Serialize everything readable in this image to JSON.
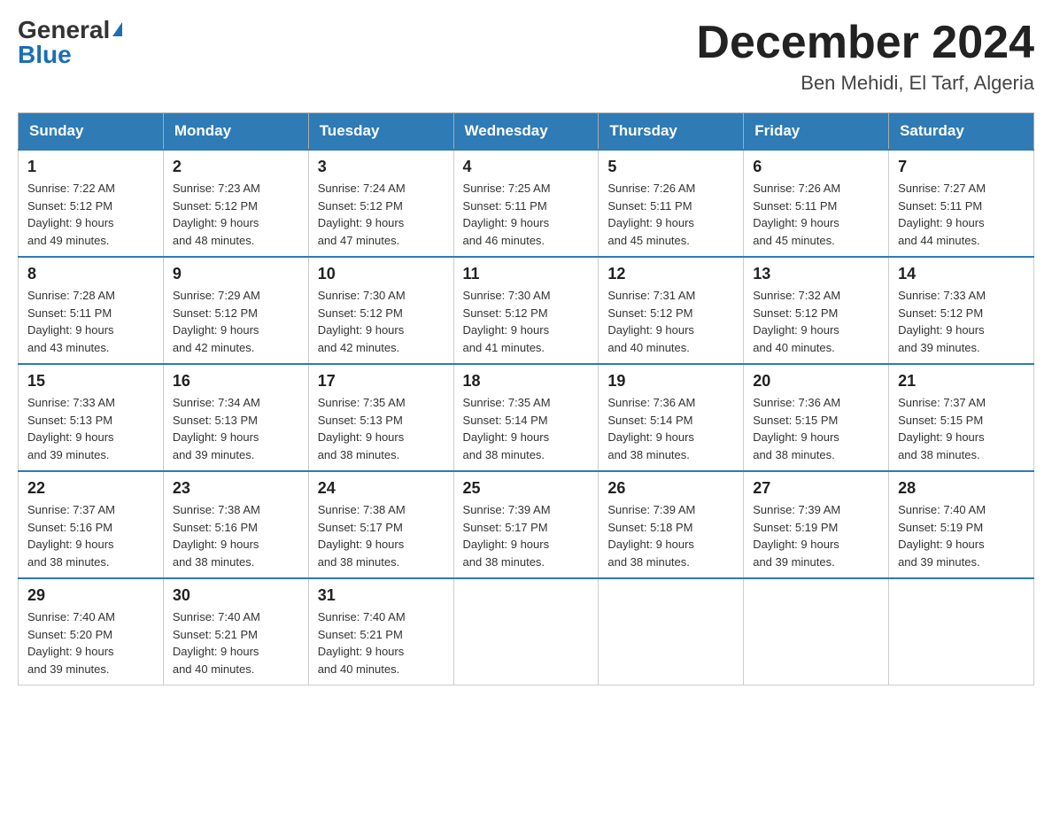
{
  "header": {
    "logo_general": "General",
    "logo_blue": "Blue",
    "month_title": "December 2024",
    "location": "Ben Mehidi, El Tarf, Algeria"
  },
  "days_of_week": [
    "Sunday",
    "Monday",
    "Tuesday",
    "Wednesday",
    "Thursday",
    "Friday",
    "Saturday"
  ],
  "weeks": [
    [
      {
        "day": "1",
        "sunrise": "7:22 AM",
        "sunset": "5:12 PM",
        "daylight": "9 hours and 49 minutes."
      },
      {
        "day": "2",
        "sunrise": "7:23 AM",
        "sunset": "5:12 PM",
        "daylight": "9 hours and 48 minutes."
      },
      {
        "day": "3",
        "sunrise": "7:24 AM",
        "sunset": "5:12 PM",
        "daylight": "9 hours and 47 minutes."
      },
      {
        "day": "4",
        "sunrise": "7:25 AM",
        "sunset": "5:11 PM",
        "daylight": "9 hours and 46 minutes."
      },
      {
        "day": "5",
        "sunrise": "7:26 AM",
        "sunset": "5:11 PM",
        "daylight": "9 hours and 45 minutes."
      },
      {
        "day": "6",
        "sunrise": "7:26 AM",
        "sunset": "5:11 PM",
        "daylight": "9 hours and 45 minutes."
      },
      {
        "day": "7",
        "sunrise": "7:27 AM",
        "sunset": "5:11 PM",
        "daylight": "9 hours and 44 minutes."
      }
    ],
    [
      {
        "day": "8",
        "sunrise": "7:28 AM",
        "sunset": "5:11 PM",
        "daylight": "9 hours and 43 minutes."
      },
      {
        "day": "9",
        "sunrise": "7:29 AM",
        "sunset": "5:12 PM",
        "daylight": "9 hours and 42 minutes."
      },
      {
        "day": "10",
        "sunrise": "7:30 AM",
        "sunset": "5:12 PM",
        "daylight": "9 hours and 42 minutes."
      },
      {
        "day": "11",
        "sunrise": "7:30 AM",
        "sunset": "5:12 PM",
        "daylight": "9 hours and 41 minutes."
      },
      {
        "day": "12",
        "sunrise": "7:31 AM",
        "sunset": "5:12 PM",
        "daylight": "9 hours and 40 minutes."
      },
      {
        "day": "13",
        "sunrise": "7:32 AM",
        "sunset": "5:12 PM",
        "daylight": "9 hours and 40 minutes."
      },
      {
        "day": "14",
        "sunrise": "7:33 AM",
        "sunset": "5:12 PM",
        "daylight": "9 hours and 39 minutes."
      }
    ],
    [
      {
        "day": "15",
        "sunrise": "7:33 AM",
        "sunset": "5:13 PM",
        "daylight": "9 hours and 39 minutes."
      },
      {
        "day": "16",
        "sunrise": "7:34 AM",
        "sunset": "5:13 PM",
        "daylight": "9 hours and 39 minutes."
      },
      {
        "day": "17",
        "sunrise": "7:35 AM",
        "sunset": "5:13 PM",
        "daylight": "9 hours and 38 minutes."
      },
      {
        "day": "18",
        "sunrise": "7:35 AM",
        "sunset": "5:14 PM",
        "daylight": "9 hours and 38 minutes."
      },
      {
        "day": "19",
        "sunrise": "7:36 AM",
        "sunset": "5:14 PM",
        "daylight": "9 hours and 38 minutes."
      },
      {
        "day": "20",
        "sunrise": "7:36 AM",
        "sunset": "5:15 PM",
        "daylight": "9 hours and 38 minutes."
      },
      {
        "day": "21",
        "sunrise": "7:37 AM",
        "sunset": "5:15 PM",
        "daylight": "9 hours and 38 minutes."
      }
    ],
    [
      {
        "day": "22",
        "sunrise": "7:37 AM",
        "sunset": "5:16 PM",
        "daylight": "9 hours and 38 minutes."
      },
      {
        "day": "23",
        "sunrise": "7:38 AM",
        "sunset": "5:16 PM",
        "daylight": "9 hours and 38 minutes."
      },
      {
        "day": "24",
        "sunrise": "7:38 AM",
        "sunset": "5:17 PM",
        "daylight": "9 hours and 38 minutes."
      },
      {
        "day": "25",
        "sunrise": "7:39 AM",
        "sunset": "5:17 PM",
        "daylight": "9 hours and 38 minutes."
      },
      {
        "day": "26",
        "sunrise": "7:39 AM",
        "sunset": "5:18 PM",
        "daylight": "9 hours and 38 minutes."
      },
      {
        "day": "27",
        "sunrise": "7:39 AM",
        "sunset": "5:19 PM",
        "daylight": "9 hours and 39 minutes."
      },
      {
        "day": "28",
        "sunrise": "7:40 AM",
        "sunset": "5:19 PM",
        "daylight": "9 hours and 39 minutes."
      }
    ],
    [
      {
        "day": "29",
        "sunrise": "7:40 AM",
        "sunset": "5:20 PM",
        "daylight": "9 hours and 39 minutes."
      },
      {
        "day": "30",
        "sunrise": "7:40 AM",
        "sunset": "5:21 PM",
        "daylight": "9 hours and 40 minutes."
      },
      {
        "day": "31",
        "sunrise": "7:40 AM",
        "sunset": "5:21 PM",
        "daylight": "9 hours and 40 minutes."
      },
      null,
      null,
      null,
      null
    ]
  ],
  "labels": {
    "sunrise_prefix": "Sunrise: ",
    "sunset_prefix": "Sunset: ",
    "daylight_prefix": "Daylight: "
  }
}
